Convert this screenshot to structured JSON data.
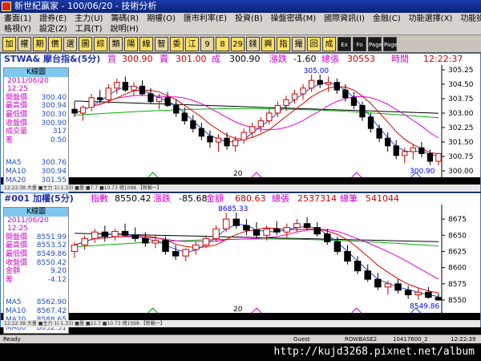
{
  "window": {
    "title": "新世紀贏家 - 100/06/20 - 技術分析"
  },
  "menu": {
    "row1": [
      "畫面(1)",
      "證券(E)",
      "主力(U)",
      "籌碼(R)",
      "期權(O)",
      "匯市利率(E)",
      "投資(B)",
      "操盤密碼(M)",
      "國際資訊(I)",
      "金融(C)",
      "功能選擇(X)",
      "功能操作(F)"
    ],
    "row2": [
      "格視(Y)",
      "設定(Z)",
      "工具(T)",
      "說明(H)"
    ]
  },
  "toolbar": [
    "加",
    "權",
    "期",
    "價",
    "選",
    "圖",
    "綜",
    "類",
    "陽",
    "線",
    "智",
    "委",
    "江",
    "9",
    "8",
    "29",
    "錢",
    "興",
    "指",
    "撮",
    "回",
    "成",
    "Ex",
    "Fo",
    "Page",
    "Page"
  ],
  "panel1": {
    "symbol": "STWA& 摩台指&(5分)",
    "bid_label": "買",
    "bid": "300.90",
    "ask_label": "賣",
    "ask": "301.00",
    "last_label": "成",
    "last": "300.90",
    "chg_label": "漲跌",
    "chg": "-1.60",
    "vol_label": "總張",
    "vol": "30553",
    "time_label": "時間",
    "time": "12:22:37",
    "infobox": {
      "title": "K線圖",
      "datetime": "2011/06/20 12:25",
      "rows": [
        {
          "k": "開盤價",
          "v": "300.40"
        },
        {
          "k": "最高價",
          "v": "300.94"
        },
        {
          "k": "最低價",
          "v": "300.30"
        },
        {
          "k": "收盤價",
          "v": "300.90"
        },
        {
          "k": "成交量",
          "v": "317"
        },
        {
          "k": "差",
          "v": "0.50"
        }
      ],
      "ma": [
        {
          "k": "MA5",
          "v": "300.76"
        },
        {
          "k": "MA10",
          "v": "300.94"
        },
        {
          "k": "MA20",
          "v": "301.55"
        },
        {
          "k": "MA60",
          "v": "302.73"
        }
      ]
    },
    "y_ticks": [
      "305.25",
      "304.50",
      "303.75",
      "303.00",
      "302.25",
      "301.50",
      "300.75",
      "300.00"
    ],
    "ylim": [
      300.0,
      305.25
    ],
    "annot_high": "305.00",
    "annot_low": "300.90",
    "xlabel": "20",
    "bottom_text": "12:22:38 大量 ■主力 1(-1.33) ■量 ■7.7 ■10.73 總1098 【新輸一】"
  },
  "panel2": {
    "symbol": "#001 加權(5分)",
    "idx_label": "指數",
    "idx": "8550.42",
    "chg_label": "漲跌",
    "chg": "-85.68",
    "amt_label": "金額",
    "amt": "680.63",
    "vol_label": "總張",
    "vol": "2537314",
    "cnt_label": "總筆",
    "cnt": "541044",
    "infobox": {
      "title": "K線圖",
      "datetime": "2011/06/20 12:25",
      "rows": [
        {
          "k": "開盤價",
          "v": "8551.99"
        },
        {
          "k": "最高價",
          "v": "8553.52"
        },
        {
          "k": "最低價",
          "v": "8549.86"
        },
        {
          "k": "收盤價",
          "v": "8550.42"
        },
        {
          "k": "金額",
          "v": "9.20"
        },
        {
          "k": "差",
          "v": "-4.12"
        }
      ],
      "ma": [
        {
          "k": "MA5",
          "v": "8562.90"
        },
        {
          "k": "MA10",
          "v": "8567.42"
        },
        {
          "k": "MA20",
          "v": "8588.65"
        },
        {
          "k": "MA60",
          "v": "8632.51"
        }
      ]
    },
    "y_ticks": [
      "8675",
      "8650",
      "8625",
      "8600",
      "8575",
      "8550"
    ],
    "ylim": [
      8540,
      8690
    ],
    "annot_high": "8685.33",
    "annot_low": "8549.86",
    "xlabel": "20",
    "bottom_text": "12:22:38 大量 ■主力 1(-1.33) ■量 ■22.7 ■10.73 總1098 【新輸一】"
  },
  "status": {
    "left": "Ready",
    "guest": "Guest",
    "server": "ROWBASE2",
    "code": "10417600_2",
    "clock": "12:22:39"
  },
  "watermark": "http://kujd3268.pixnet.net/album",
  "colors": {
    "up": "#d00000",
    "down": "#000000",
    "ma5": "#2050d0",
    "ma10": "#e00000",
    "ma20": "#e000e0",
    "ma60": "#00b000",
    "ma120": "#000000"
  },
  "chart_data": [
    {
      "type": "candlestick",
      "title": "STWA& 摩台指&(5分)",
      "ylim": [
        300.0,
        305.25
      ],
      "candles": [
        [
          303.2,
          303.6,
          302.8,
          303.0
        ],
        [
          303.0,
          303.4,
          302.6,
          303.3
        ],
        [
          303.3,
          304.0,
          303.1,
          303.8
        ],
        [
          303.8,
          304.2,
          303.5,
          303.7
        ],
        [
          303.7,
          304.5,
          303.5,
          304.3
        ],
        [
          304.3,
          304.8,
          304.0,
          304.6
        ],
        [
          304.6,
          304.9,
          304.1,
          304.2
        ],
        [
          304.2,
          304.6,
          303.9,
          304.4
        ],
        [
          304.4,
          304.7,
          303.9,
          304.0
        ],
        [
          304.0,
          304.3,
          303.5,
          303.6
        ],
        [
          303.6,
          304.0,
          303.2,
          303.8
        ],
        [
          303.8,
          304.1,
          303.3,
          303.4
        ],
        [
          303.4,
          303.7,
          302.8,
          303.0
        ],
        [
          303.0,
          303.3,
          302.4,
          302.6
        ],
        [
          302.6,
          302.9,
          302.0,
          302.2
        ],
        [
          302.2,
          302.5,
          301.6,
          301.8
        ],
        [
          301.8,
          302.1,
          301.2,
          301.5
        ],
        [
          301.5,
          301.9,
          301.0,
          301.7
        ],
        [
          301.7,
          302.0,
          301.1,
          301.3
        ],
        [
          301.3,
          301.8,
          301.0,
          301.6
        ],
        [
          301.6,
          302.2,
          301.4,
          302.0
        ],
        [
          302.0,
          302.5,
          301.7,
          302.3
        ],
        [
          302.3,
          302.8,
          302.0,
          302.6
        ],
        [
          302.6,
          303.2,
          302.4,
          303.0
        ],
        [
          303.0,
          303.6,
          302.8,
          303.4
        ],
        [
          303.4,
          303.9,
          303.1,
          303.7
        ],
        [
          303.7,
          304.2,
          303.5,
          304.0
        ],
        [
          304.0,
          304.5,
          303.7,
          304.3
        ],
        [
          304.3,
          305.0,
          304.1,
          304.7
        ],
        [
          304.7,
          305.0,
          304.3,
          304.5
        ],
        [
          304.5,
          304.9,
          304.1,
          304.6
        ],
        [
          304.6,
          304.8,
          304.0,
          304.2
        ],
        [
          304.2,
          304.5,
          303.6,
          303.8
        ],
        [
          303.8,
          304.1,
          303.2,
          303.4
        ],
        [
          303.4,
          303.6,
          302.6,
          302.8
        ],
        [
          302.8,
          303.0,
          302.0,
          302.2
        ],
        [
          302.2,
          302.4,
          301.5,
          301.7
        ],
        [
          301.7,
          302.0,
          301.0,
          301.3
        ],
        [
          301.3,
          301.6,
          300.6,
          300.8
        ],
        [
          300.8,
          301.2,
          300.4,
          301.0
        ],
        [
          301.0,
          301.4,
          300.6,
          301.2
        ],
        [
          301.2,
          301.5,
          300.7,
          300.9
        ],
        [
          300.9,
          301.1,
          300.3,
          300.5
        ],
        [
          300.5,
          300.94,
          300.3,
          300.9
        ]
      ],
      "ma_levels": {
        "MA5": 300.76,
        "MA10": 300.94,
        "MA20": 301.55,
        "MA60": 302.73
      }
    },
    {
      "type": "candlestick",
      "title": "#001 加權(5分)",
      "ylim": [
        8540,
        8690
      ],
      "candles": [
        [
          8625,
          8640,
          8615,
          8635
        ],
        [
          8635,
          8650,
          8628,
          8645
        ],
        [
          8645,
          8660,
          8638,
          8655
        ],
        [
          8655,
          8665,
          8640,
          8648
        ],
        [
          8648,
          8660,
          8642,
          8656
        ],
        [
          8656,
          8668,
          8648,
          8650
        ],
        [
          8650,
          8662,
          8640,
          8645
        ],
        [
          8645,
          8655,
          8632,
          8638
        ],
        [
          8638,
          8650,
          8630,
          8642
        ],
        [
          8642,
          8648,
          8620,
          8625
        ],
        [
          8625,
          8635,
          8612,
          8618
        ],
        [
          8618,
          8630,
          8610,
          8628
        ],
        [
          8628,
          8640,
          8620,
          8635
        ],
        [
          8635,
          8650,
          8630,
          8645
        ],
        [
          8645,
          8665,
          8640,
          8660
        ],
        [
          8660,
          8685,
          8655,
          8675
        ],
        [
          8675,
          8685,
          8660,
          8665
        ],
        [
          8665,
          8675,
          8650,
          8658
        ],
        [
          8658,
          8670,
          8645,
          8650
        ],
        [
          8650,
          8665,
          8642,
          8660
        ],
        [
          8660,
          8672,
          8650,
          8655
        ],
        [
          8655,
          8668,
          8645,
          8662
        ],
        [
          8662,
          8675,
          8655,
          8668
        ],
        [
          8668,
          8678,
          8658,
          8662
        ],
        [
          8662,
          8670,
          8648,
          8652
        ],
        [
          8652,
          8660,
          8635,
          8640
        ],
        [
          8640,
          8648,
          8620,
          8625
        ],
        [
          8625,
          8635,
          8605,
          8610
        ],
        [
          8610,
          8618,
          8590,
          8595
        ],
        [
          8595,
          8605,
          8578,
          8582
        ],
        [
          8582,
          8592,
          8565,
          8570
        ],
        [
          8570,
          8580,
          8558,
          8575
        ],
        [
          8575,
          8582,
          8560,
          8565
        ],
        [
          8565,
          8572,
          8552,
          8558
        ],
        [
          8558,
          8568,
          8550,
          8562
        ],
        [
          8562,
          8570,
          8552,
          8554
        ],
        [
          8554,
          8560,
          8549,
          8550
        ]
      ],
      "ma_levels": {
        "MA5": 8562.9,
        "MA10": 8567.42,
        "MA20": 8588.65,
        "MA60": 8632.51
      }
    }
  ]
}
